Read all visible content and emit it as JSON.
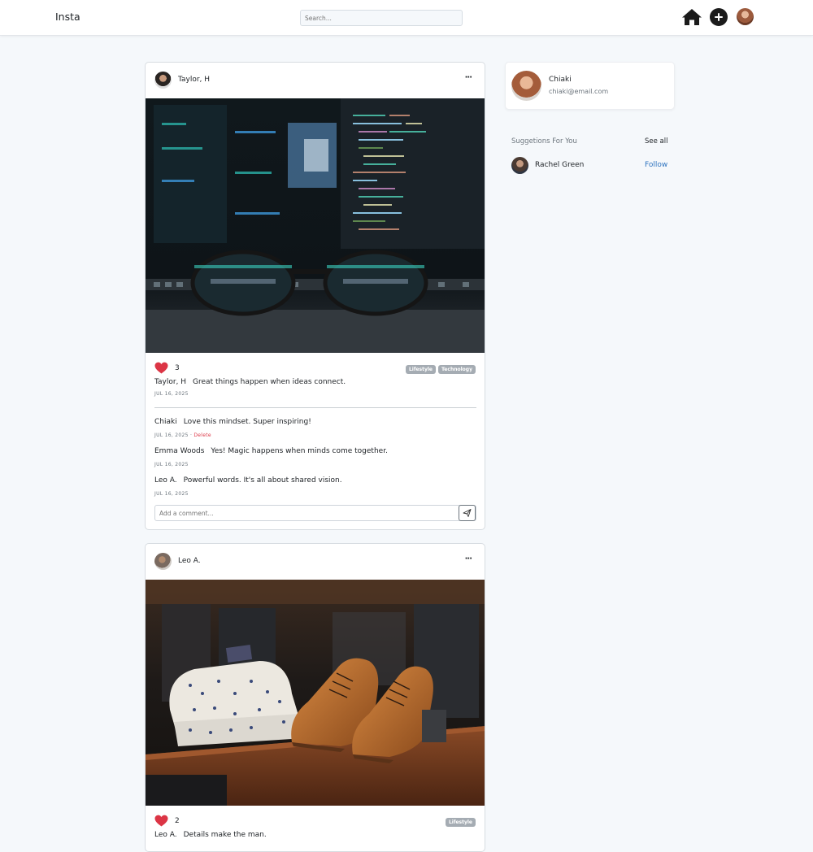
{
  "app": {
    "brand": "Insta"
  },
  "search": {
    "placeholder": "Search..."
  },
  "nav": {
    "home_icon": "home-icon",
    "add_icon": "plus-circle-icon",
    "avatar": "user-avatar"
  },
  "posts": [
    {
      "author": "Taylor, H",
      "likes": "3",
      "tags": [
        "Lifestyle",
        "Technology"
      ],
      "caption_author": "Taylor, H",
      "caption": "Great things happen when ideas connect.",
      "date": "JUL 16, 2025",
      "comments": [
        {
          "author": "Chiaki",
          "text": "Love this mindset. Super inspiring!",
          "date": "JUL 16, 2025",
          "delete": "Delete"
        },
        {
          "author": "Emma Woods",
          "text": "Yes! Magic happens when minds come together.",
          "date": "JUL 16, 2025"
        },
        {
          "author": "Leo A.",
          "text": "Powerful words. It's all about shared vision.",
          "date": "JUL 16, 2025"
        }
      ],
      "comment_placeholder": "Add a comment...",
      "more": "···"
    },
    {
      "author": "Leo A.",
      "likes": "2",
      "tags": [
        "Lifestyle"
      ],
      "caption_author": "Leo A.",
      "caption": "Details make the man.",
      "more": "···"
    }
  ],
  "profile": {
    "name": "Chiaki",
    "email": "chiaki@email.com"
  },
  "suggestions": {
    "title": "Suggetions For You",
    "see_all": "See all",
    "items": [
      {
        "name": "Rachel Green",
        "action": "Follow"
      }
    ]
  },
  "colors": {
    "heart": "#dc3545",
    "follow": "#2f74c0",
    "delete": "#dc3545",
    "tag_bg": "#a5acb3"
  }
}
